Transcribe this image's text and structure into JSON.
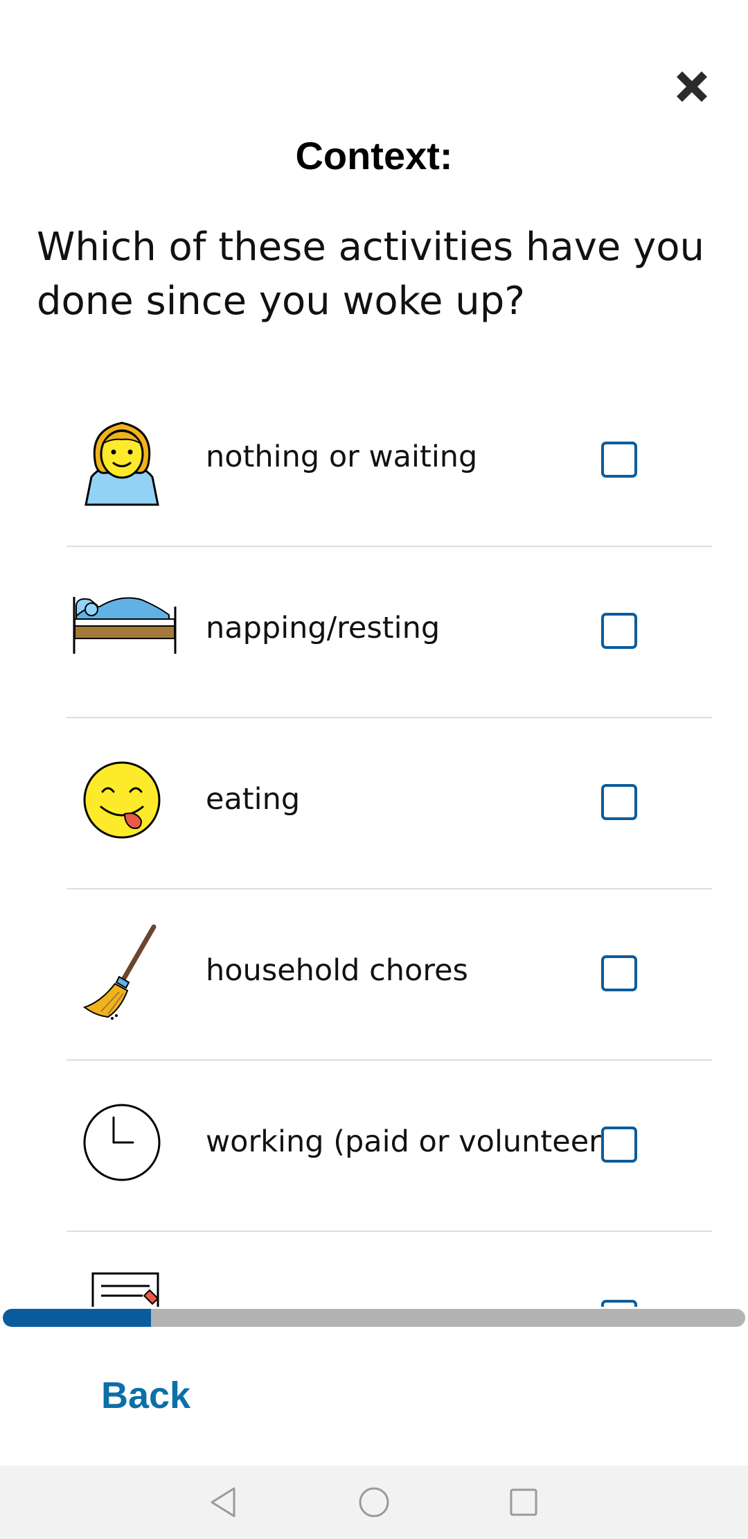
{
  "header": {
    "close_icon": "close-icon",
    "title": "Context:"
  },
  "question": "Which of these activities have you done since you woke up?",
  "activities": [
    {
      "label": "nothing or waiting",
      "icon": "person-waiting-icon",
      "checked": false
    },
    {
      "label": "napping/resting",
      "icon": "bed-icon",
      "checked": false
    },
    {
      "label": "eating",
      "icon": "savoring-face-icon",
      "checked": false
    },
    {
      "label": "household chores",
      "icon": "broom-icon",
      "checked": false
    },
    {
      "label": "working (paid or volunteer)",
      "icon": "clock-icon",
      "checked": false
    },
    {
      "label": "",
      "icon": "document-icon",
      "checked": false
    }
  ],
  "progress": {
    "fraction": 0.2
  },
  "footer": {
    "back_label": "Back"
  },
  "colors": {
    "accent": "#0b5c9c",
    "link": "#0b6fa8",
    "progress_track": "#b3b3b3",
    "divider": "#dddddd"
  },
  "system_nav": {
    "back_icon": "nav-back-icon",
    "home_icon": "nav-home-icon",
    "recents_icon": "nav-recents-icon"
  }
}
